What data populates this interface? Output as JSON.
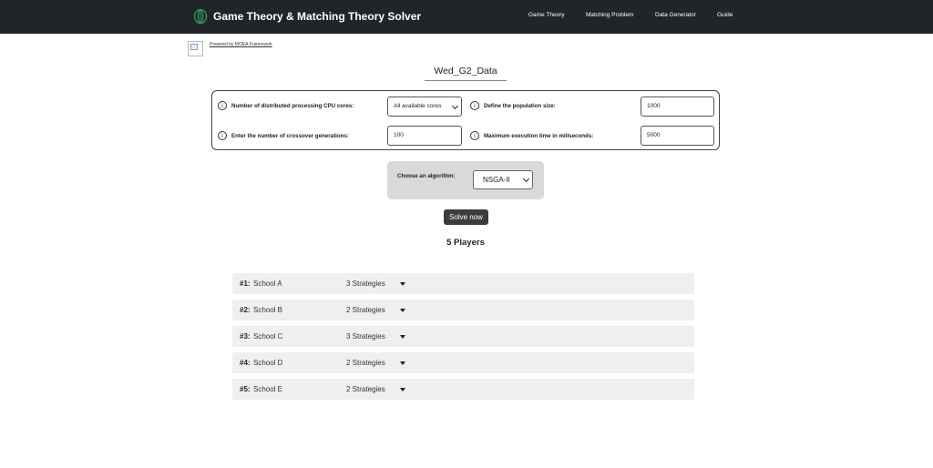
{
  "header": {
    "brand_title": "Game Theory & Matching Theory Solver",
    "nav": [
      {
        "label": "Game Theory"
      },
      {
        "label": "Matching Problem"
      },
      {
        "label": "Data Generator"
      },
      {
        "label": "Guide"
      }
    ]
  },
  "moea": {
    "link_text": "Powered by MOEA Framework"
  },
  "dataset": {
    "title": "Wed_G2_Data"
  },
  "params": {
    "cpu_cores": {
      "label": "Number of distributed processing CPU cores:",
      "value": "All available cores"
    },
    "population": {
      "label": "Define the population size:",
      "value": "1000"
    },
    "generations": {
      "label": "Enter the number of crossover generations:",
      "value": "100"
    },
    "max_time": {
      "label": "Maximum execution time in millseconds:",
      "value": "5000"
    }
  },
  "algorithm": {
    "label": "Choose an algorithm:",
    "selected": "NSGA-II"
  },
  "solve_button": "Solve now",
  "players": {
    "heading": "5 Players",
    "items": [
      {
        "num": "#1:",
        "name": "School A",
        "strategies": "3 Strategies"
      },
      {
        "num": "#2:",
        "name": "School B",
        "strategies": "2 Strategies"
      },
      {
        "num": "#3:",
        "name": "School C",
        "strategies": "3 Strategies"
      },
      {
        "num": "#4:",
        "name": "School D",
        "strategies": "2 Strategies"
      },
      {
        "num": "#5:",
        "name": "School E",
        "strategies": "2 Strategies"
      }
    ]
  },
  "colors": {
    "header_bg": "#212529",
    "logo_accent": "#2e9e56",
    "row_bg": "#efefef",
    "button_bg": "#3c3c3c",
    "algo_panel_bg": "#d9d9d9"
  }
}
